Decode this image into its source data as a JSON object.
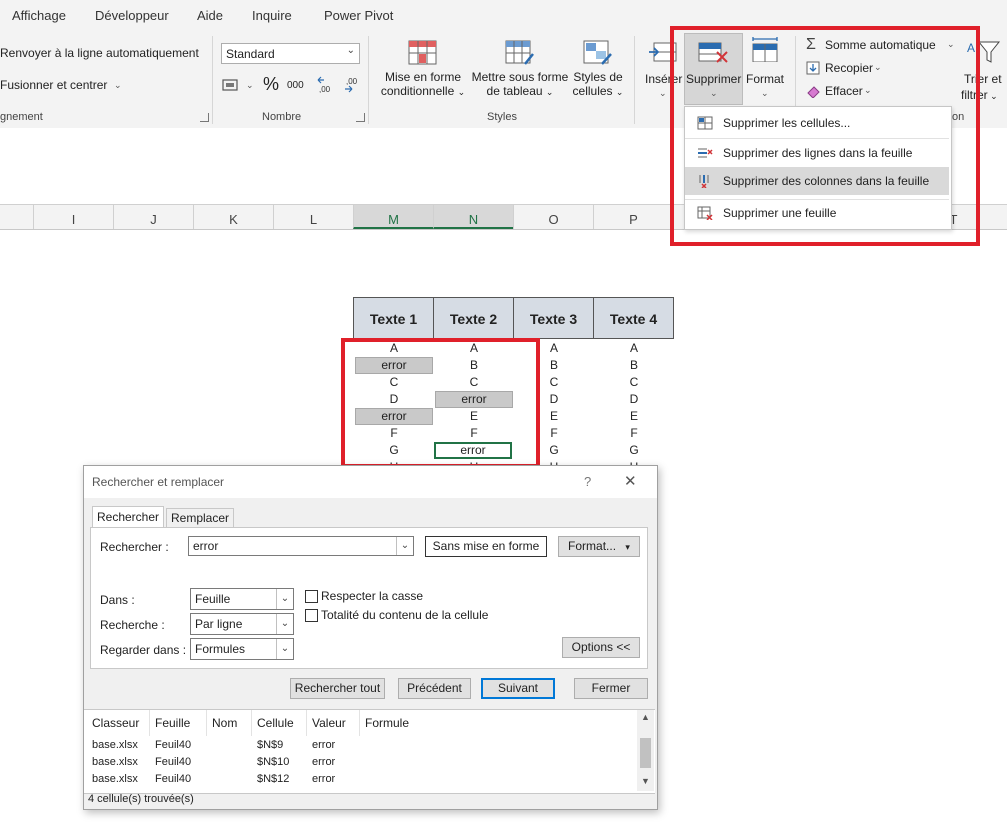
{
  "ribbon": {
    "tabs": [
      "Affichage",
      "Développeur",
      "Aide",
      "Inquire",
      "Power Pivot"
    ],
    "alignment": {
      "wrap_text": "Renvoyer à la ligne automatiquement",
      "merge_center": "Fusionner et centrer",
      "group_label": "gnement"
    },
    "number": {
      "format_value": "Standard",
      "percent": "%",
      "thousands": "000",
      "group_label": "Nombre"
    },
    "styles": {
      "conditional": [
        "Mise en forme",
        "conditionnelle"
      ],
      "as_table": [
        "Mettre sous forme",
        "de tableau"
      ],
      "cell_styles": [
        "Styles de",
        "cellules"
      ],
      "group_label": "Styles"
    },
    "cells": {
      "insert": "Insérer",
      "delete": "Supprimer",
      "format": "Format"
    },
    "editing": {
      "autosum": "Somme automatique",
      "fill": "Recopier",
      "clear": "Effacer",
      "sort_filter": [
        "Trier et",
        "filtrer"
      ],
      "group_label_fragment": "on"
    }
  },
  "delete_menu": {
    "items": [
      {
        "label": "Supprimer les cellules...",
        "icon": "delete-cells-icon"
      },
      {
        "label": "Supprimer des lignes dans la feuille",
        "icon": "delete-rows-icon"
      },
      {
        "label": "Supprimer des colonnes dans la feuille",
        "icon": "delete-columns-icon"
      },
      {
        "label": "Supprimer une feuille",
        "icon": "delete-sheet-icon"
      }
    ]
  },
  "column_headers": [
    "I",
    "J",
    "K",
    "L",
    "M",
    "N",
    "O",
    "P",
    "T"
  ],
  "sheet": {
    "headers": [
      "Texte 1",
      "Texte 2",
      "Texte 3",
      "Texte 4"
    ],
    "col1": [
      "A",
      "error",
      "C",
      "D",
      "error",
      "F",
      "G",
      "H"
    ],
    "col2": [
      "A",
      "B",
      "C",
      "error",
      "E",
      "F",
      "error",
      "H"
    ],
    "col3": [
      "A",
      "B",
      "C",
      "D",
      "E",
      "F",
      "G",
      "H"
    ],
    "col4": [
      "A",
      "B",
      "C",
      "D",
      "E",
      "F",
      "G",
      "H"
    ]
  },
  "dialog": {
    "title": "Rechercher et remplacer",
    "help": "?",
    "close": "✕",
    "tabs": [
      "Rechercher",
      "Remplacer"
    ],
    "find_label": "Rechercher :",
    "find_value": "error",
    "no_format": "Sans mise en forme",
    "format_btn": "Format...",
    "within_label": "Dans :",
    "within_value": "Feuille",
    "search_label": "Recherche :",
    "search_value": "Par ligne",
    "look_in_label": "Regarder dans :",
    "look_in_value": "Formules",
    "match_case": "Respecter la casse",
    "entire_cell": "Totalité du contenu de la cellule",
    "options_btn": "Options <<",
    "find_all": "Rechercher tout",
    "find_prev": "Précédent",
    "find_next": "Suivant",
    "close_btn": "Fermer",
    "results_headers": [
      "Classeur",
      "Feuille",
      "Nom",
      "Cellule",
      "Valeur",
      "Formule"
    ],
    "results": [
      [
        "base.xlsx",
        "Feuil40",
        "",
        "$N$9",
        "error",
        ""
      ],
      [
        "base.xlsx",
        "Feuil40",
        "",
        "$N$10",
        "error",
        ""
      ],
      [
        "base.xlsx",
        "Feuil40",
        "",
        "$N$12",
        "error",
        ""
      ]
    ],
    "status": "4 cellule(s) trouvée(s)"
  }
}
